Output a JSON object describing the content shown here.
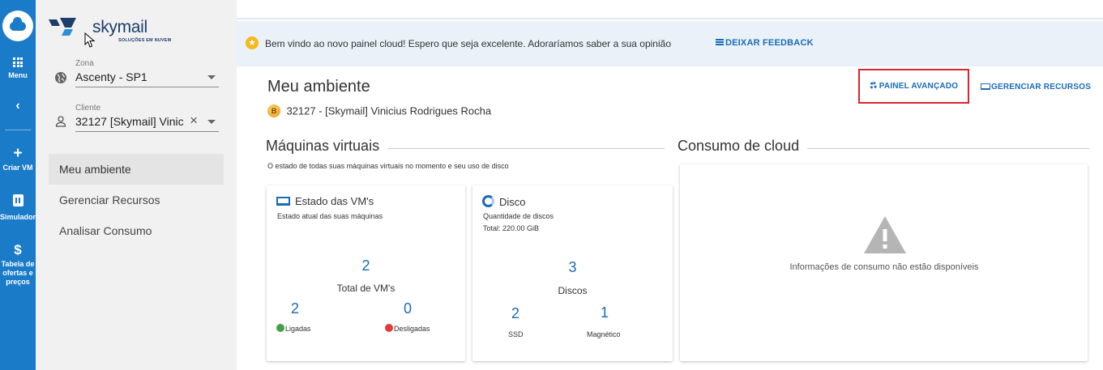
{
  "rail": {
    "menu_label": "Menu",
    "create_vm_label": "Criar VM",
    "simulator_label": "Simulador",
    "pricing_label_1": "Tabela de",
    "pricing_label_2": "ofertas e",
    "pricing_label_3": "preços",
    "accent": "#1a7bc9"
  },
  "brand": {
    "name": "skymail",
    "tagline": "SOLUÇÕES EM NUVEM"
  },
  "sidebar": {
    "zone_label": "Zona",
    "zone_value": "Ascenty - SP1",
    "client_label": "Cliente",
    "client_value": "32127 [Skymail] Viniciu",
    "nav": [
      {
        "label": "Meu ambiente",
        "active": true
      },
      {
        "label": "Gerenciar Recursos",
        "active": false
      },
      {
        "label": "Analisar Consumo",
        "active": false
      }
    ]
  },
  "notice": {
    "text": "Bem vindo ao novo painel cloud! Espero que seja excelente. Adoraríamos saber a sua opinião",
    "feedback_label": "DEIXAR FEEDBACK"
  },
  "header": {
    "title": "Meu ambiente",
    "client_badge": "B",
    "client_name": "32127 - [Skymail] Vinicius Rodrigues Rocha",
    "advanced_panel_label": "PAINEL AVANÇADO",
    "manage_resources_label": "GERENCIAR RECURSOS",
    "highlight_color": "#d9262c"
  },
  "vms_section": {
    "title": "Máquinas virtuais",
    "subtitle": "O estado de todas suas máquinas virtuais no momento e seu uso de disco",
    "vm_card": {
      "title": "Estado das VM's",
      "subtitle": "Estado atual das suas máquinas",
      "total_value": "2",
      "total_label": "Total de VM's",
      "on_value": "2",
      "on_label": "Ligadas",
      "on_color": "#43a047",
      "off_value": "0",
      "off_label": "Desligadas",
      "off_color": "#e53935"
    },
    "disk_card": {
      "title": "Disco",
      "subtitle_1": "Quantidade de discos",
      "subtitle_2": "Total: 220.00 GiB",
      "total_value": "3",
      "total_label": "Discos",
      "ssd_value": "2",
      "ssd_label": "SSD",
      "magnetic_value": "1",
      "magnetic_label": "Magnético"
    }
  },
  "consumption_section": {
    "title": "Consumo de cloud",
    "empty_message": "Informações de consumo não estão disponíveis"
  }
}
